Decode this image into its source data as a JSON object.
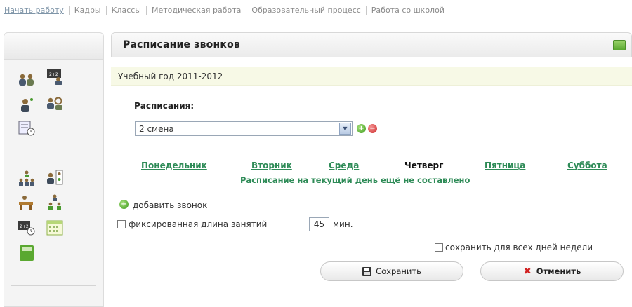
{
  "topnav": {
    "items": [
      "Начать работу",
      "Кадры",
      "Классы",
      "Методическая работа",
      "Образовательный процесс",
      "Работа со школой"
    ]
  },
  "panel": {
    "title": "Расписание звонков",
    "academic_year": "Учебный год 2011-2012"
  },
  "schedules": {
    "label": "Расписания:",
    "selected": "2 смена",
    "add_icon": "plus-circle",
    "remove_icon": "minus-circle"
  },
  "days": {
    "items": [
      "Понедельник",
      "Вторник",
      "Среда",
      "Четверг",
      "Пятница",
      "Суббота"
    ],
    "current": "Четверг",
    "note": "Расписание на текущий день ещё не составлено"
  },
  "actions": {
    "add_bell": "добавить звонок",
    "fixed_length_label": "фиксированная длина занятий",
    "fixed_length_value": "45",
    "minutes_unit": "мин.",
    "save_all_days": "сохранить для всех дней недели",
    "save_button": "Сохранить",
    "cancel_button": "Отменить"
  },
  "colors": {
    "accent_green": "#2e8b57",
    "year_bar": "#f7f9e6",
    "header_button": "#5aa830",
    "cancel_icon": "#d12020"
  }
}
